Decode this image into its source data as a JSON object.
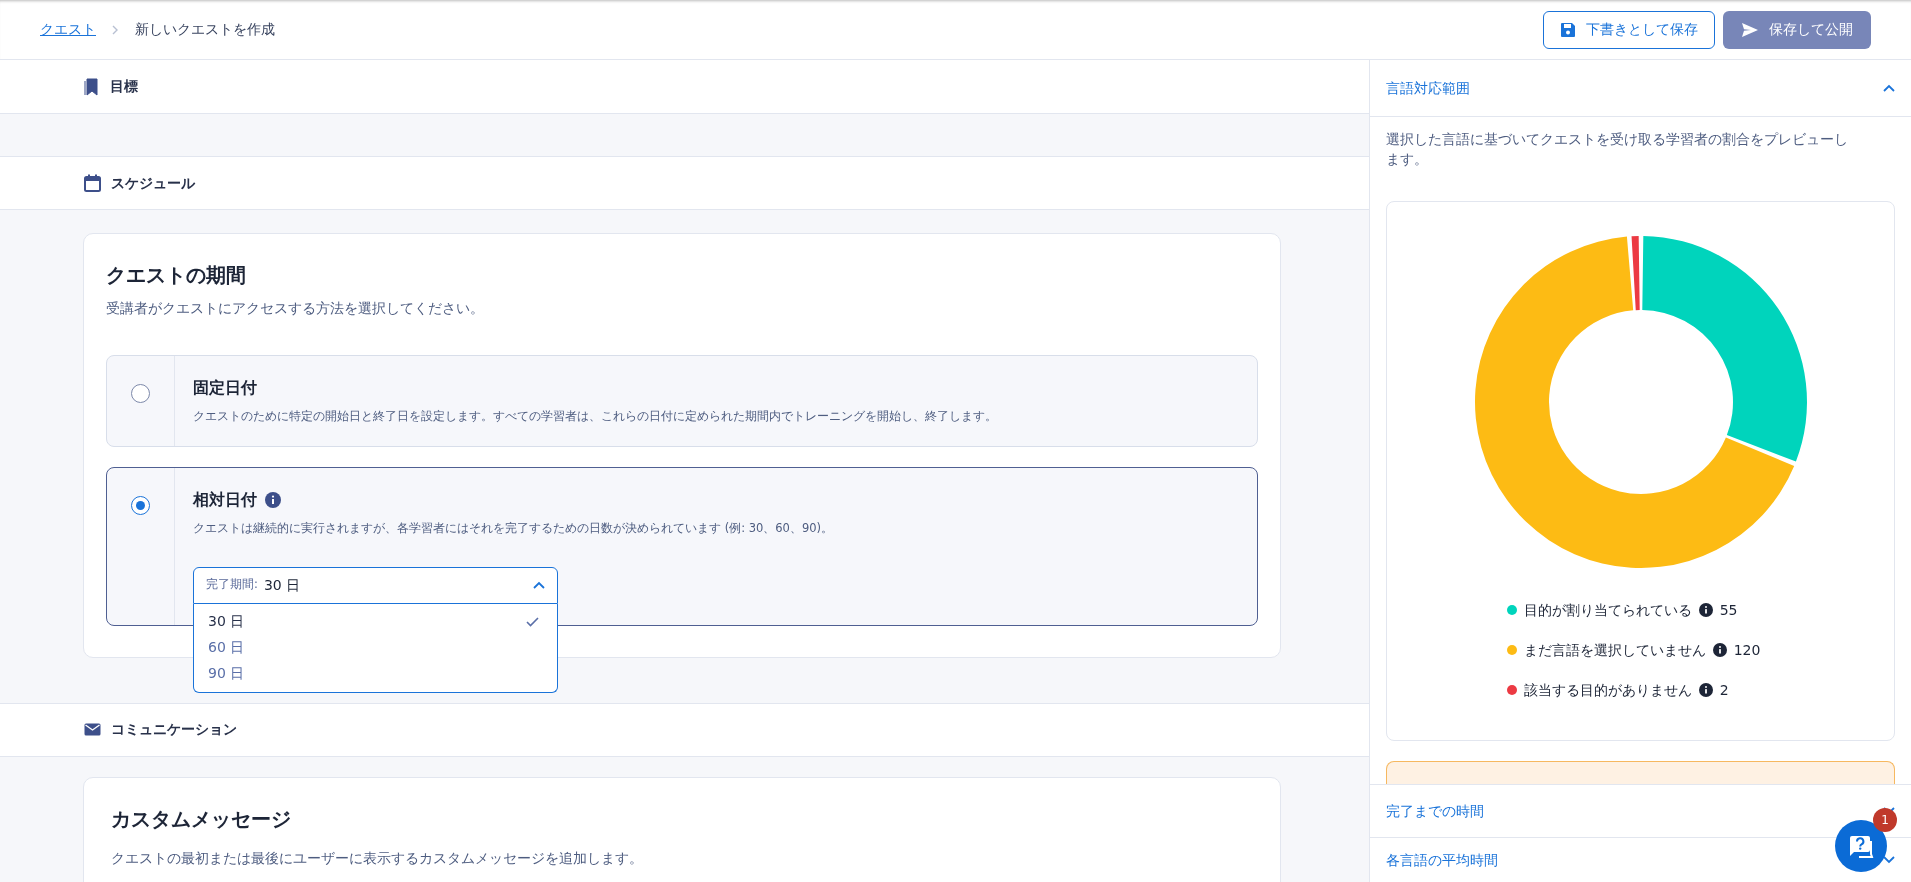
{
  "breadcrumb": [
    {
      "label": "クエスト",
      "kind": "link"
    },
    {
      "label": "新しいクエストを作成",
      "kind": "current"
    }
  ],
  "header_buttons": [
    {
      "label": "下書きとして保存",
      "kind": "outline",
      "disabled": false
    },
    {
      "label": "保存して公開",
      "kind": "solid",
      "disabled": true
    }
  ],
  "goal_section": {
    "title": "目標"
  },
  "schedule_section": {
    "title": "スケジュール",
    "card": {
      "title": "クエストの期間",
      "subtitle": "受講者がクエストにアクセスする方法を選択してください。",
      "options": [
        {
          "title": "固定日付",
          "description": "クエストのために特定の開始日と終了日を設定します。すべての学習者は、これらの日付に定められた期間内でトレーニングを開始し、終了します。",
          "selected": false,
          "info": false
        },
        {
          "title": "相対日付",
          "description": "クエストは継続的に実行されますが、各学習者にはそれを完了するための日数が決められています (例: 30、60、90)。",
          "selected": true,
          "info": true,
          "dropdown": {
            "label": "完了期間:",
            "value": "30 日",
            "expanded": true,
            "items": [
              {
                "label": "30 日",
                "selected": true
              },
              {
                "label": "60 日",
                "selected": false
              },
              {
                "label": "90 日",
                "selected": false
              }
            ]
          }
        }
      ]
    }
  },
  "communication_section": {
    "title": "コミュニケーション",
    "card": {
      "title": "カスタムメッセージ",
      "text": "クエストの最初または最後にユーザーに表示するカスタムメッセージを追加します。"
    }
  },
  "language_coverage": {
    "title": "言語対応範囲",
    "expanded": true,
    "description": "選択した言語に基づいてクエストを受け取る学習者の割合をプレビューします。",
    "chart_data": {
      "type": "donut",
      "categories": [
        "目的が割り当てられている",
        "まだ言語を選択していません",
        "該当する目的がありません"
      ],
      "values": [
        31.07,
        67.8,
        1.13
      ]
    },
    "legend": [
      {
        "count": "55",
        "color": "#00d4bc"
      },
      {
        "count": "120",
        "color": "#fdbb14"
      },
      {
        "count": "2",
        "color": "#ec3a43"
      }
    ]
  },
  "collapsed_sections": [
    {
      "title": "完了までの時間",
      "expanded": false
    },
    {
      "title": "各言語の平均時間",
      "expanded": false
    }
  ],
  "help_button": {
    "badge": "1"
  }
}
